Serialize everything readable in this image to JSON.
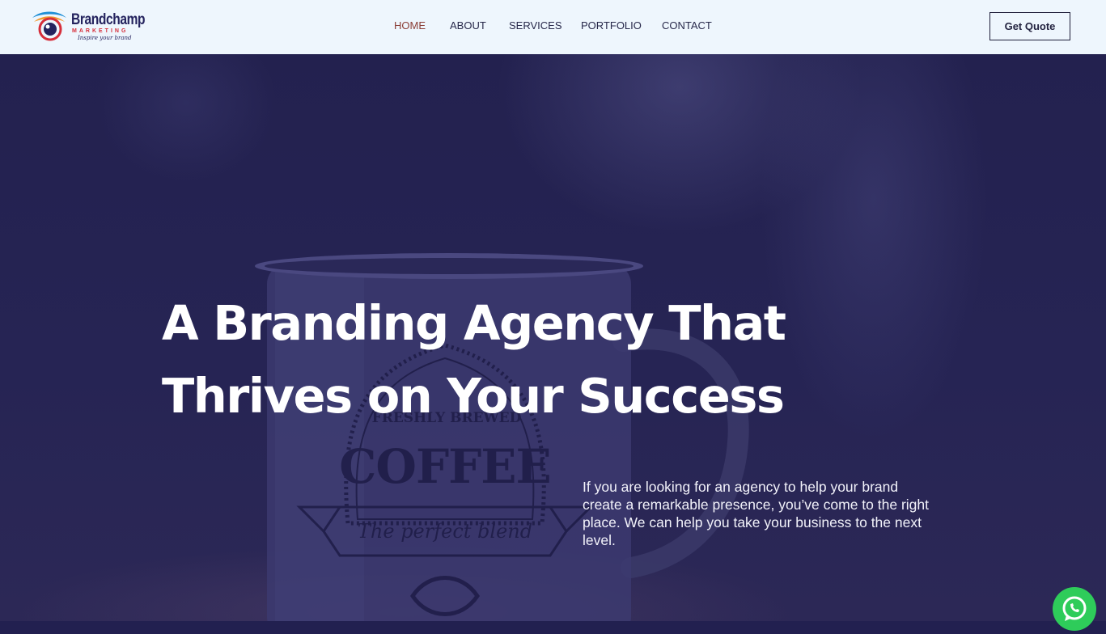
{
  "brand": {
    "name": "Brandchamp",
    "sub": "MARKETING",
    "tagline": "Inspire your brand",
    "colors": {
      "navy": "#24235e",
      "red": "#d62e3a",
      "blue": "#1f8fd6",
      "orange": "#f29a2e"
    }
  },
  "nav": {
    "items": [
      {
        "label": "HOME",
        "active": true
      },
      {
        "label": "ABOUT",
        "active": false
      },
      {
        "label": "SERVICES",
        "active": false
      },
      {
        "label": "PORTFOLIO",
        "active": false
      },
      {
        "label": "CONTACT",
        "active": false
      }
    ],
    "cta_label": "Get Quote"
  },
  "hero": {
    "title_line1": "A Branding Agency That",
    "title_line2": "Thrives on Your Success",
    "description": "If you are looking for an agency to help your brand create a remarkable presence, you’ve come to the right place. We can help you take your business to the next level.",
    "mug": {
      "top_text": "FRESHLY BREWED",
      "main_text": "COFFEE",
      "ribbon_text": "The perfect blend"
    },
    "overlay_color": "#222050"
  },
  "floating": {
    "icon": "whatsapp-icon",
    "color": "#2ecc5a"
  }
}
